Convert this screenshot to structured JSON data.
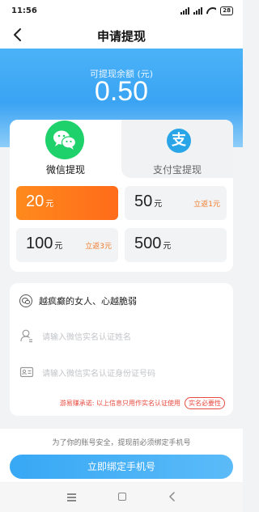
{
  "status_bar": {
    "time": "11:56",
    "battery": "28"
  },
  "nav": {
    "title": "申请提现"
  },
  "balance": {
    "label": "可提现余额 (元)",
    "amount": "0.50"
  },
  "tabs": [
    {
      "label": "微信提现",
      "icon": "wechat-icon",
      "selected": true
    },
    {
      "label": "支付宝提现",
      "icon": "alipay-icon",
      "icon_glyph": "支",
      "selected": false
    }
  ],
  "amounts": [
    {
      "value": "20",
      "unit": "元",
      "rebate": "",
      "selected": true
    },
    {
      "value": "50",
      "unit": "元",
      "rebate": "立返1元",
      "selected": false
    },
    {
      "value": "100",
      "unit": "元",
      "rebate": "立返3元",
      "selected": false
    },
    {
      "value": "500",
      "unit": "元",
      "rebate": "",
      "selected": false
    }
  ],
  "form": {
    "user_name": "越疯癫的女人、心越脆弱",
    "name_placeholder": "请输入微信实名认证姓名",
    "id_placeholder": "请输入微信实名认证身份证号码",
    "commitment": "游易赚承诺: 以上信息只用作实名认证使用",
    "commitment_badge": "实名必要性"
  },
  "bottom": {
    "security_note": "为了你的账号安全，提现前必须绑定手机号",
    "bind_button": "立即绑定手机号"
  },
  "colors": {
    "primary_blue": "#3aa3f3",
    "selected_orange": "#ff7a1a",
    "rebate_orange": "#f07a2a",
    "wechat_green": "#1fd16a",
    "alipay_blue": "#2aa6e8",
    "warning_red": "#e84a3e"
  }
}
